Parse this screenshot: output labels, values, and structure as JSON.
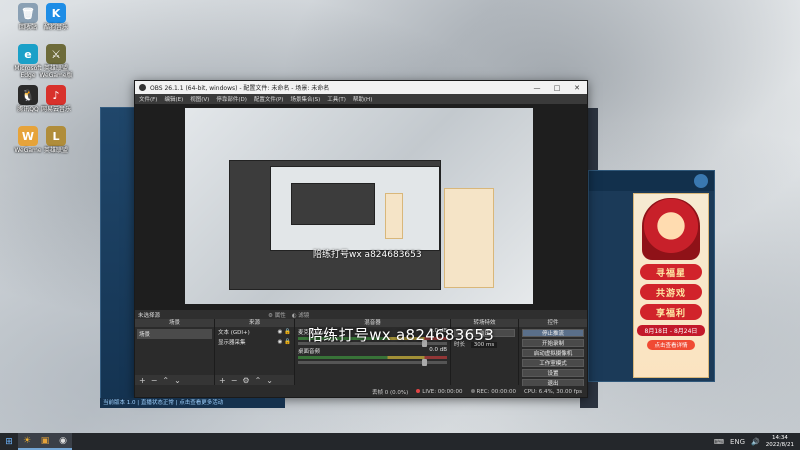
{
  "desktop": {
    "icons": [
      {
        "name": "recycle-bin-icon",
        "label": "回收站",
        "glyph": "🗑",
        "color": "#8aa0b4"
      },
      {
        "name": "kugou-icon",
        "label": "酷狗音乐",
        "glyph": "K",
        "color": "#1e8de6"
      },
      {
        "name": "edge-icon",
        "label": "Microsoft Edge",
        "glyph": "e",
        "color": "#1aa0c8"
      },
      {
        "name": "lol-icon",
        "label": "英雄联盟WeGame版",
        "glyph": "⚔",
        "color": "#6d6b3a"
      },
      {
        "name": "qq-icon",
        "label": "腾讯QQ",
        "glyph": "🐧",
        "color": "#2a2a2a"
      },
      {
        "name": "netease-music-icon",
        "label": "网易云音乐",
        "glyph": "♪",
        "color": "#d8312b"
      },
      {
        "name": "wegame-icon",
        "label": "WeGame",
        "glyph": "W",
        "color": "#e6a33a"
      },
      {
        "name": "game-icon",
        "label": "英雄联盟",
        "glyph": "L",
        "color": "#b08d3a"
      }
    ]
  },
  "obs": {
    "title": "OBS 26.1.1 (64-bit, windows) - 配置文件: 未命名 - 场景: 未命名",
    "window_buttons": [
      "—",
      "□",
      "✕"
    ],
    "menu": [
      "文件(F)",
      "编辑(E)",
      "视图(V)",
      "停靠部件(D)",
      "配置文件(P)",
      "场景集合(S)",
      "工具(T)",
      "帮助(H)"
    ],
    "source_bar": {
      "label": "未选择源",
      "properties": "属性",
      "filters": "滤镜"
    },
    "scenes": {
      "header": "场景",
      "items": [
        "场景"
      ]
    },
    "sources": {
      "header": "来源",
      "items": [
        "文本 (GDI+)",
        "显示器采集"
      ]
    },
    "mixer": {
      "header": "混音器",
      "channels": [
        {
          "name": "麦克风/Aux",
          "db": "0.0 dB"
        },
        {
          "name": "桌面音频",
          "db": "0.0 dB"
        }
      ]
    },
    "transitions": {
      "header": "转场特效",
      "type": "淡出",
      "duration_label": "时长",
      "duration": "300 ms"
    },
    "controls": {
      "header": "控件",
      "buttons": [
        "停止推流",
        "开始录制",
        "启动虚拟摄像机",
        "工作室模式",
        "设置",
        "退出"
      ]
    },
    "status": {
      "dropped": "丢帧 0 (0.0%)",
      "live": "LIVE: 00:00:00",
      "rec": "REC: 00:00:00",
      "cpu": "CPU: 6.4%, 30.00 fps"
    }
  },
  "overlay": {
    "text": "陪练打号wx a824683653"
  },
  "promo": {
    "lines": [
      "寻福星",
      "共游戏",
      "享福利"
    ],
    "date": "8月18日 - 8月24日",
    "cta": "点击查看详情"
  },
  "game_status": "当前版本 1.0 | 直播状态正常 | 点击查看更多活动",
  "taskbar": {
    "items": [
      "⊞",
      "☀",
      "▣",
      "◉"
    ],
    "tray": [
      "⌨",
      "ENG",
      "🔊"
    ],
    "time": "14:34",
    "date": "2022/8/21"
  }
}
